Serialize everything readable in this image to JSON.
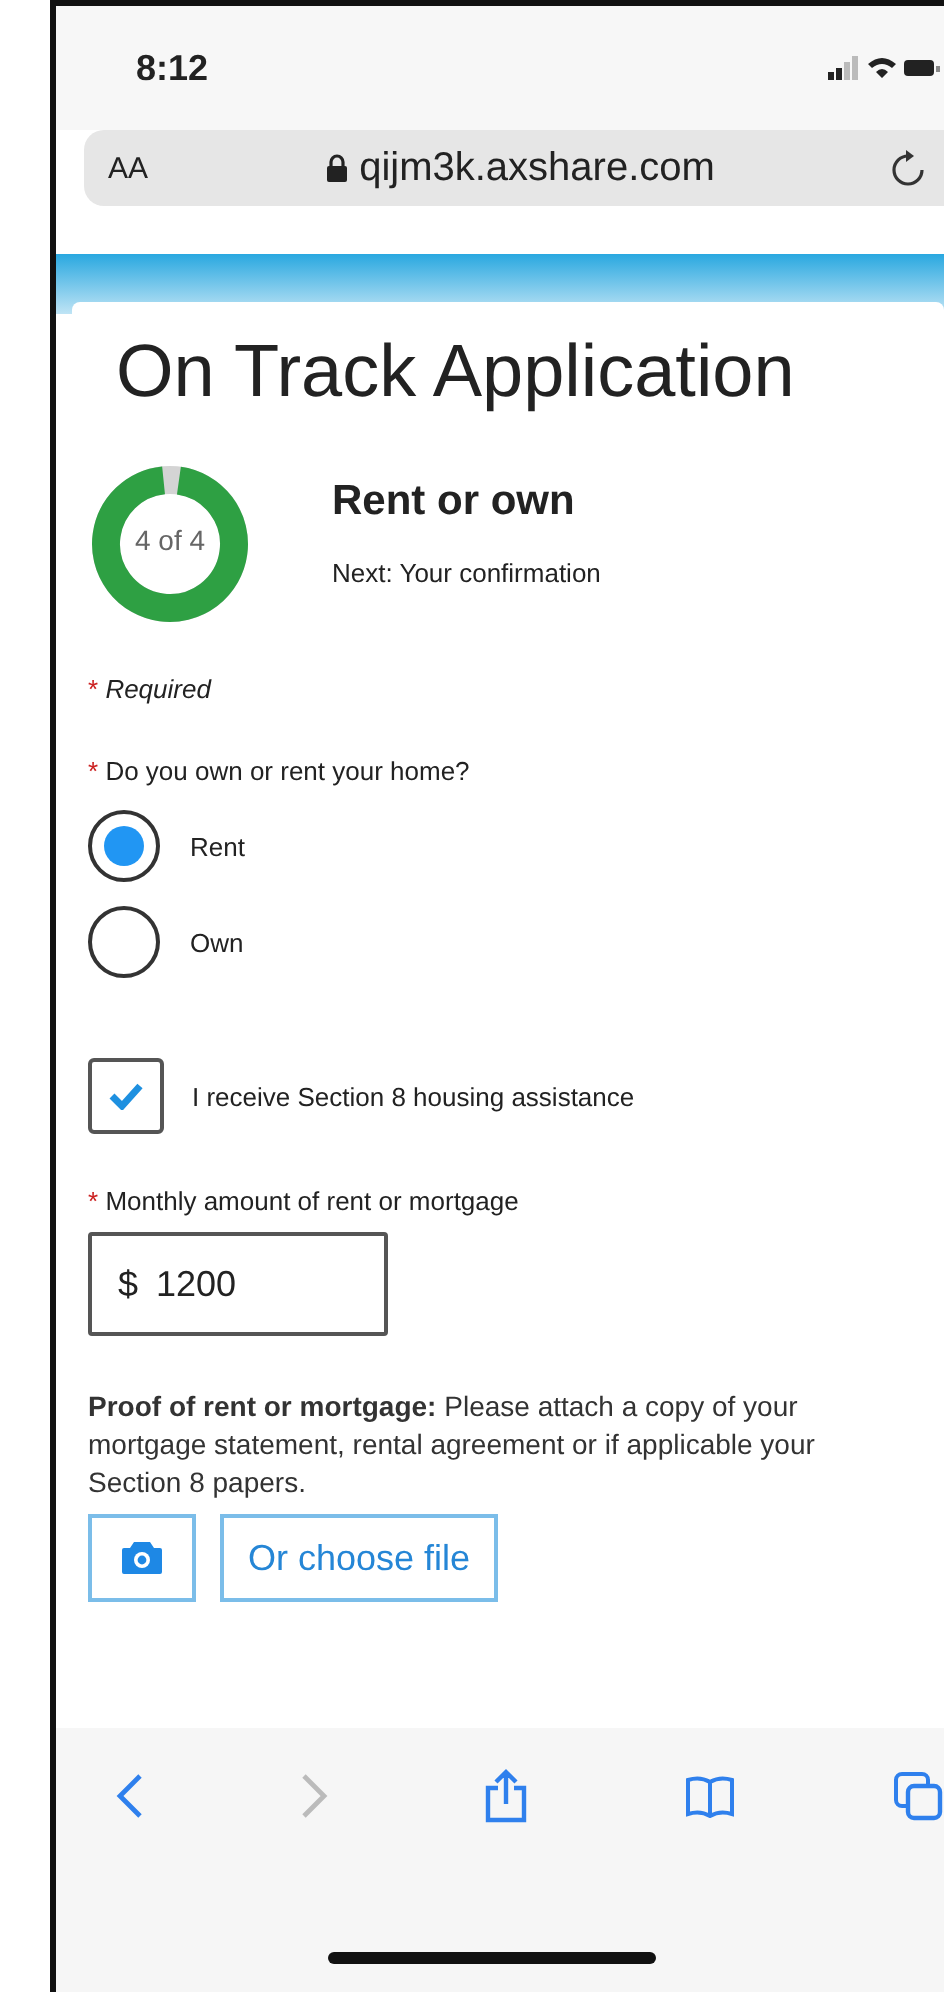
{
  "status_bar": {
    "time": "8:12"
  },
  "address_bar": {
    "text_size": "AA",
    "url": "qijm3k.axshare.com"
  },
  "header": {
    "title": "On Track Application"
  },
  "progress": {
    "step": "4 of 4",
    "level": 0.96,
    "title": "Rent or own",
    "next": "Next: Your confirmation"
  },
  "required_note": {
    "mark": "*",
    "text": "Required"
  },
  "question": {
    "mark": "*",
    "text": "Do you own or rent your home?"
  },
  "options": [
    {
      "label": "Rent",
      "selected": true
    },
    {
      "label": "Own",
      "selected": false
    }
  ],
  "assistance": {
    "label": "I receive Section 8 housing assistance",
    "checked": true
  },
  "amount": {
    "mark": "*",
    "label": "Monthly amount of rent or mortgage",
    "currency": "$",
    "value": "1200"
  },
  "proof": {
    "text": "**Proof of rent or mortgage:** Please attach a copy of your mortgage statement, rental agreement or if applicable your Section 8 papers.",
    "file_button": "Or choose file"
  },
  "toolbar": [
    {
      "kind": "back",
      "disabled": false
    },
    {
      "kind": "forward",
      "disabled": true
    },
    {
      "kind": "share",
      "disabled": false
    },
    {
      "kind": "bookmarks",
      "disabled": false
    },
    {
      "kind": "tabs",
      "disabled": false
    }
  ]
}
